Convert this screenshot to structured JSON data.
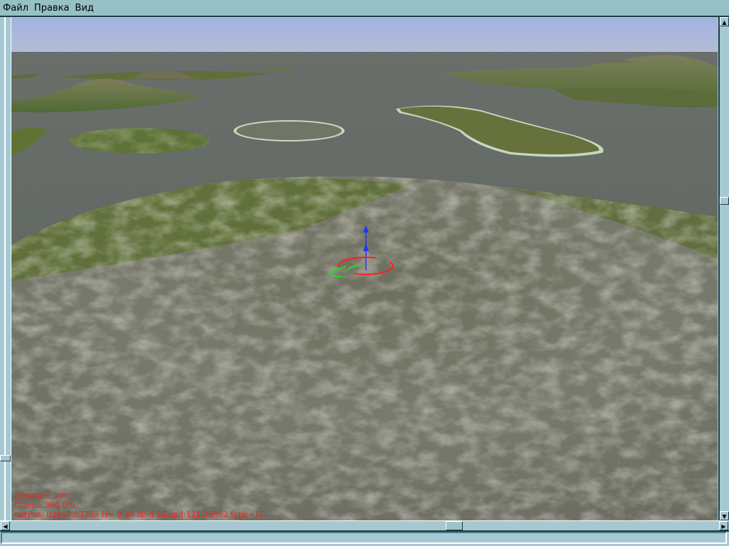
{
  "menu": {
    "items": [
      "Файл",
      "Правка",
      "Вид"
    ]
  },
  "hud": {
    "distance": "Distance: 290",
    "orient": "Orient: 360 0 0",
    "curpos": "curPos: 82458 83735 H= 0.20 land HLand:121.36962 type=11"
  },
  "scrollbars": {
    "up_icon": "▲",
    "down_icon": "▼",
    "left_icon": "◀",
    "right_icon": "▶"
  },
  "colors": {
    "hud_text": "#ff1a1a",
    "chrome": "#a6c8d2"
  }
}
